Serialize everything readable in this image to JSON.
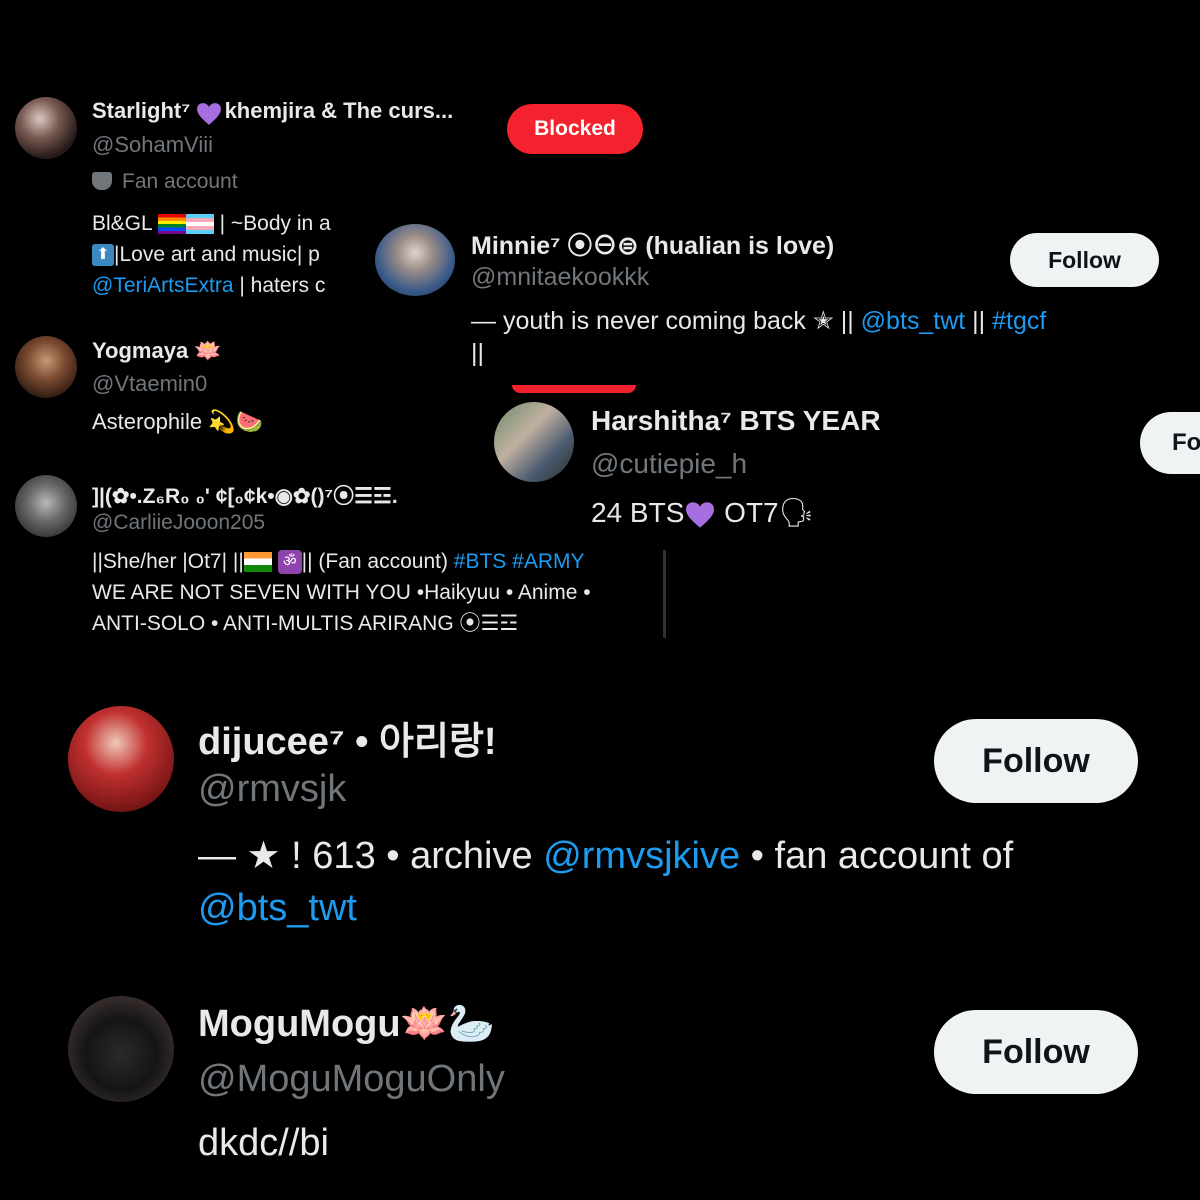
{
  "accounts": {
    "starlight": {
      "name_a": "Starlight⁷",
      "name_b": "khemjira & The curs...",
      "handle": "@SohamViii",
      "badge": "Fan account",
      "bio_line1": "Bl&GL",
      "bio_line1_tail": "| ~Body in a",
      "bio_line2": "|Love art and music| p",
      "bio_line3_link": "@TeriArtsExtra",
      "bio_line3_tail": " | haters c",
      "button": "Blocked",
      "accent": "#f4212e"
    },
    "minnie": {
      "name": "Minnie⁷ ⦿⊖⊜ (hualian is love)",
      "handle": "@mnitaekookkk",
      "bio_prefix": "— youth is never coming back ✭ || ",
      "bio_link1": "@bts_twt",
      "bio_mid": " || ",
      "bio_link2": "#tgcf",
      "bio_line2": "||",
      "button": "Follow"
    },
    "yogmaya": {
      "name": "Yogmaya 🪷",
      "handle": "@Vtaemin0",
      "bio": "Asterophile 💫🍉"
    },
    "harshitha": {
      "name": "Harshitha⁷ BTS YEAR",
      "handle": "@cutiepie_h",
      "bio": "24 BTS",
      "bio_tail": " OT7🗣",
      "button": "Fo"
    },
    "carlie": {
      "name": "]|(✿•.Z₆R₀ ₀' ¢[₀¢k•◉✿()⁷⦿☰☲.",
      "handle": "@CarliieJooon205",
      "bio_line1": "||She/her |Ot7| ||",
      "bio_line1_om": "ॐ",
      "bio_line1_mid": "|| (Fan account) ",
      "bio_line1_link": "#BTS #ARMY",
      "bio_line2": "WE ARE NOT SEVEN WITH YOU •Haikyuu • Anime •",
      "bio_line3": "ANTI-SOLO • ANTI-MULTIS ARIRANG ⦿☰☲"
    },
    "dijucee": {
      "name": "dijucee⁷ • 아리랑!",
      "handle": "@rmvsjk",
      "bio_prefix": "— ★ ! 613 • archive ",
      "bio_link": "@rmvsjkive",
      "bio_tail": " • fan account of",
      "bio_line2_link": "@bts_twt",
      "button": "Follow"
    },
    "mogumogu": {
      "name": "MoguMogu🪷🦢",
      "handle": "@MoguMoguOnly",
      "bio": "dkdc//bi",
      "button": "Follow"
    }
  },
  "colors": {
    "link": "#1d9bf0",
    "heart": "#a66ee0",
    "background": "#000000"
  },
  "icons": [
    "mask-icon",
    "up-arrow-icon",
    "purple-heart-icon",
    "flag-icons",
    "avatar-images"
  ]
}
